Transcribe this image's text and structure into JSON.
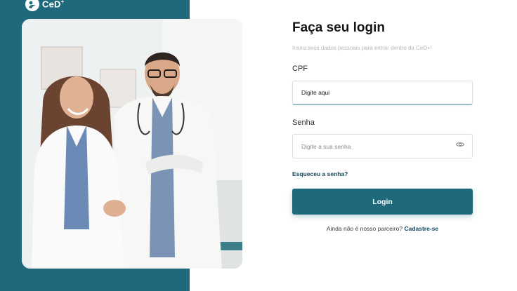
{
  "brand": {
    "name": "CeD",
    "suffix": "+"
  },
  "login": {
    "title": "Faça seu login",
    "subtitle": "Insira seus dados pessoais para entrar dentro da CeD+!",
    "cpf_label": "CPF",
    "cpf_placeholder": "Digite aqui",
    "password_label": "Senha",
    "password_placeholder": "Digite a sua senha",
    "forgot_label": "Esqueceu a senha?",
    "submit_label": "Login",
    "signup_prompt": "Ainda não é nosso parceiro?",
    "signup_link": "Cadastre-se"
  },
  "colors": {
    "brand_teal": "#1e6a7c",
    "link_dark": "#15485a"
  },
  "icons": {
    "brand": "brand-logo-icon",
    "password_toggle": "eye-icon"
  }
}
